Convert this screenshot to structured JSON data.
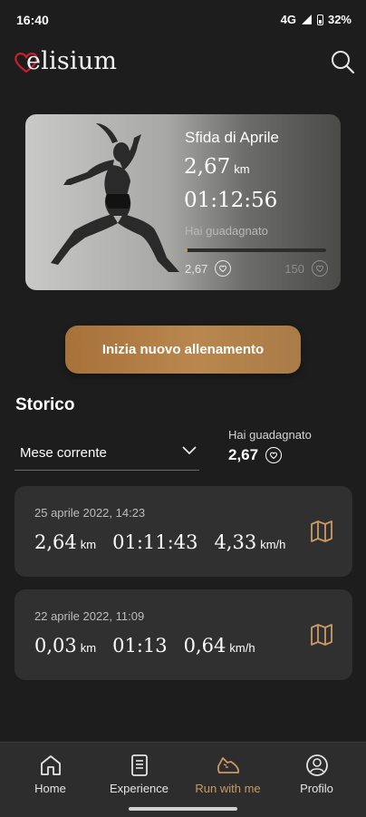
{
  "status_bar": {
    "time": "16:40",
    "network": "4G",
    "battery": "32%"
  },
  "app": {
    "logo_text": "elisium",
    "accent": "#c99b63",
    "brand_heart": "#c8202a"
  },
  "challenge": {
    "title": "Sfida di Aprile",
    "distance": "2,67",
    "distance_unit": "km",
    "duration": "01:12:56",
    "earned_label": "Hai guadagnato",
    "current_points": "2,67",
    "goal_points": "150",
    "progress_fraction": 0.018
  },
  "start_button": {
    "label": "Inizia nuovo allenamento"
  },
  "history": {
    "title": "Storico",
    "period_select": {
      "value": "Mese corrente"
    },
    "earned_label": "Hai guadagnato",
    "earned_value": "2,67",
    "entries": [
      {
        "date": "25 aprile 2022, 14:23",
        "distance": "2,64",
        "distance_unit": "km",
        "duration": "01:11:43",
        "speed": "4,33",
        "speed_unit": "km/h"
      },
      {
        "date": "22 aprile 2022, 11:09",
        "distance": "0,03",
        "distance_unit": "km",
        "duration": "01:13",
        "speed": "0,64",
        "speed_unit": "km/h"
      }
    ]
  },
  "nav": {
    "items": [
      {
        "label": "Home",
        "icon": "home-icon"
      },
      {
        "label": "Experience",
        "icon": "document-icon"
      },
      {
        "label": "Run with me",
        "icon": "shoe-icon",
        "active": true
      },
      {
        "label": "Profilo",
        "icon": "user-icon"
      }
    ]
  }
}
